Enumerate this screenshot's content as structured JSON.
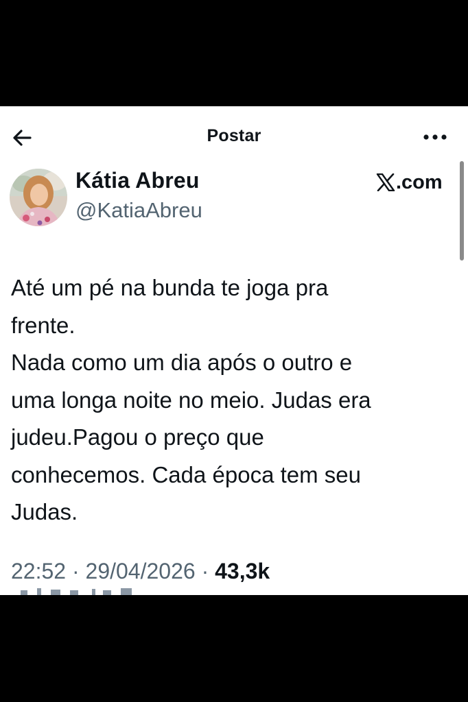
{
  "header": {
    "title": "Postar",
    "back_icon": "arrow-left-icon",
    "more_icon": "more-horizontal-icon"
  },
  "author": {
    "display_name": "Kátia Abreu",
    "handle": "@KatiaAbreu"
  },
  "brand": {
    "logo_icon": "x-logo-icon",
    "text": ".com"
  },
  "post": {
    "lines": [
      "Até um pé na bunda te joga pra",
      "frente.",
      "Nada como um dia após o outro e",
      "uma longa noite no meio. Judas era",
      "judeu.Pagou o preço que",
      "conhecemos. Cada época tem seu",
      "Judas."
    ]
  },
  "meta": {
    "time": "22:52",
    "separator": " · ",
    "date": "29/04/2026",
    "views": "43,3k"
  },
  "colors": {
    "text": "#0f1419",
    "secondary_text": "#536471",
    "background": "#ffffff",
    "frame": "#000000"
  }
}
